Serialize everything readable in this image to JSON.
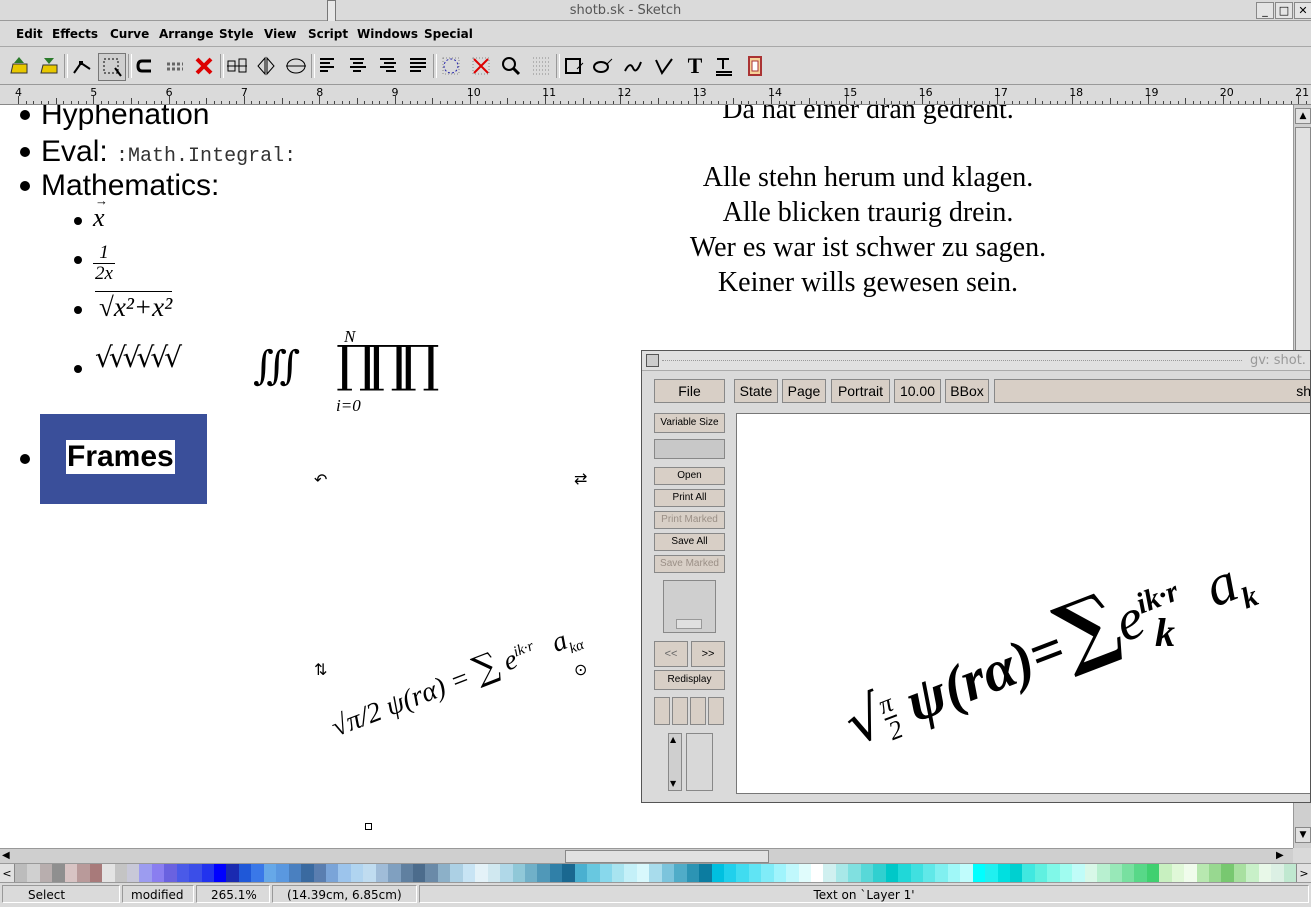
{
  "window": {
    "title": "shotb.sk - Sketch",
    "buttons": [
      "_",
      "□",
      "✕"
    ]
  },
  "menu": [
    "Edit",
    "Effects",
    "Curve",
    "Arrange",
    "Style",
    "View",
    "Script",
    "Windows",
    "Special"
  ],
  "toolbar": {
    "icons": [
      "open-icon",
      "save-icon",
      "edit-mode-icon",
      "select-mode-icon",
      "undo-icon",
      "redo-icon",
      "delete-icon",
      "align-icon",
      "flip-vertical-icon",
      "flip-horizontal-icon",
      "text-left-icon",
      "text-center-icon",
      "text-right-icon",
      "text-justify-icon",
      "snap-icon",
      "no-snap-icon",
      "zoom-icon",
      "grid-icon",
      "rectangle-icon",
      "ellipse-icon",
      "polyline-icon",
      "bezier-icon",
      "text-tool-icon",
      "text-path-icon",
      "image-icon"
    ],
    "text_glyph": "T"
  },
  "ruler": {
    "labels": [
      "4",
      "5",
      "6",
      "7",
      "8",
      "9",
      "10",
      "11",
      "12",
      "13",
      "14",
      "15",
      "16",
      "17",
      "18",
      "19",
      "20",
      "21"
    ]
  },
  "canvas": {
    "bullets": {
      "hyphenation": "Hyphenation",
      "eval": "Eval:",
      "eval_code": ":Math.Integral:",
      "mathematics": "Mathematics:",
      "frames": "Frames"
    },
    "math": {
      "vec_x": "x",
      "vec_arrow": "→",
      "frac_num": "1",
      "frac_den": "2x",
      "sqrt_expr": "√x²+x²",
      "nested_roots": "√√√√√√",
      "triple_integral": "∭",
      "prod_top": "N",
      "prod_symbols": "∏∏∏",
      "prod_bottom": "i=0"
    },
    "poem": {
      "cut_line": "Da hat einer dran gedreht.",
      "lines": [
        "Alle stehn herum und klagen.",
        "Alle blicken traurig drein.",
        "Wer es war ist schwer zu sagen.",
        "Keiner wills gewesen sein."
      ]
    },
    "handles": {
      "top_left": "↶",
      "top_right": "⇄",
      "bottom_left": "⇅",
      "center": "⊙"
    },
    "formula": {
      "left": "√π/2 ψ(rα) =",
      "sum": "∑",
      "exp": "e",
      "exp_sup": "ik·r",
      "right": "a",
      "right_sub": "kα"
    }
  },
  "gv": {
    "title": "gv: shot.",
    "file": "File",
    "state": "State",
    "page": "Page",
    "orientation": "Portrait",
    "zoom": "10.00",
    "bbox": "BBox",
    "filename_partial": "sh",
    "variable_size": "Variable Size",
    "open": "Open",
    "print_all": "Print All",
    "print_marked": "Print Marked",
    "save_all": "Save All",
    "save_marked": "Save Marked",
    "prev": "<<",
    "next": ">>",
    "redisplay": "Redisplay",
    "formula": {
      "sqrt": "√",
      "pi": "π",
      "two": "2",
      "psi": "ψ(rα)",
      "eq": "=",
      "sum": "∑",
      "k": "k",
      "exp": "e",
      "exp_sup": "ik·r",
      "a": "a",
      "a_sub": "k"
    }
  },
  "status": {
    "mode": "Select",
    "modified": "modified",
    "zoom": "265.1%",
    "coords": "(14.39cm, 6.85cm)",
    "info": "Text on `Layer 1'"
  },
  "palette": [
    "#bcbcbc",
    "#d0d0d0",
    "#b8aeae",
    "#8f8f8f",
    "#d8c4c4",
    "#b99a9a",
    "#a87a7a",
    "#e3e3e3",
    "#c4c4c4",
    "#c8c8d8",
    "#9c9cf0",
    "#8a7ef0",
    "#6a62e0",
    "#4a5ae8",
    "#3b4ee8",
    "#2233ee",
    "#0000ff",
    "#1a2ab0",
    "#1f58d8",
    "#3a78e8",
    "#66a8e8",
    "#5a98e0",
    "#4a80c0",
    "#3a6aa0",
    "#5a7eb0",
    "#7aa4d8",
    "#9cc4ec",
    "#b0d4f0",
    "#c0dcf0",
    "#a0bcd8",
    "#80a0c0",
    "#6080a0",
    "#4c6c8c",
    "#6a8aa8",
    "#8cb0c8",
    "#acd0e4",
    "#c8e4f4",
    "#e4f2f8",
    "#d0e8f0",
    "#b0d8e8",
    "#90c8d8",
    "#70b0c8",
    "#5098b8",
    "#3080a8",
    "#1a6890",
    "#4ab0d0",
    "#68c8e0",
    "#88d8ec",
    "#a8e4f0",
    "#c4f0f8",
    "#d8f8fc",
    "#a8dcec",
    "#7cc4dc",
    "#50acc8",
    "#2c94b4",
    "#0c7ca0",
    "#00c0e0",
    "#20d0ec",
    "#40dcf0",
    "#60e4f4",
    "#80ecf8",
    "#a0f4fc",
    "#c0f8fc",
    "#e0fcfc",
    "#ffffff",
    "#d0f0f0",
    "#a8e8e8",
    "#80e0e0",
    "#58d8d8",
    "#30d0d0",
    "#00c8c8",
    "#20d8d8",
    "#40e0e0",
    "#60e8e8",
    "#80f0f0",
    "#a0f8f8",
    "#c0fcfc",
    "#00ffff",
    "#20f0f0",
    "#00e0e0",
    "#00d0d0",
    "#40e8e0",
    "#60f0e0",
    "#80f8e8",
    "#a0fcf0",
    "#c0fcf8",
    "#d8f8e8",
    "#b8f0d0",
    "#98e8b8",
    "#78e0a0",
    "#58d888",
    "#40d070",
    "#c8f0c0",
    "#e0f8d8",
    "#f0fcec",
    "#b8e8b0",
    "#98d890",
    "#78c870",
    "#a8e0a0",
    "#c8f0c8",
    "#e8f8e8",
    "#dcf0e4",
    "#c0e8d0"
  ]
}
